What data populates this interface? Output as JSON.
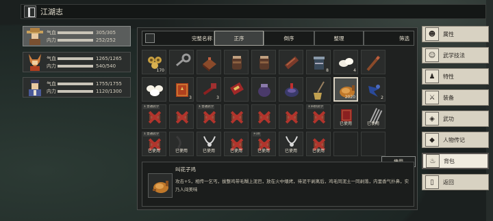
{
  "header": {
    "title": "江湖志"
  },
  "characters": [
    {
      "hp_label": "气血",
      "hp": "305/305",
      "mp_label": "内力",
      "mp": "252/252",
      "selected": true
    },
    {
      "hp_label": "气血",
      "hp": "1265/1265",
      "mp_label": "内力",
      "mp": "540/540",
      "selected": false
    },
    {
      "hp_label": "气血",
      "hp": "1755/1755",
      "mp_label": "内力",
      "mp": "1120/1300",
      "selected": false
    }
  ],
  "tabs": {
    "full_name": "完整名称",
    "sort_asc": "正序",
    "sort_desc": "倒序",
    "arrange": "整理",
    "filter": "筛选"
  },
  "items": [
    {
      "icon": "coins-icon",
      "count": "170",
      "badge": "",
      "used": ""
    },
    {
      "icon": "key-icon",
      "count": "",
      "badge": "",
      "used": ""
    },
    {
      "icon": "crate-icon",
      "count": "",
      "badge": "",
      "used": ""
    },
    {
      "icon": "jar-icon",
      "count": "",
      "badge": "",
      "used": ""
    },
    {
      "icon": "jar-icon",
      "count": "",
      "badge": "",
      "used": ""
    },
    {
      "icon": "scroll-icon",
      "count": "",
      "badge": "",
      "used": ""
    },
    {
      "icon": "pot-icon",
      "count": "8",
      "badge": "",
      "used": ""
    },
    {
      "icon": "bun-icon",
      "count": "4",
      "badge": "",
      "used": ""
    },
    {
      "icon": "stick-icon",
      "count": "",
      "badge": "",
      "used": ""
    },
    {
      "icon": "buns-icon",
      "count": "",
      "badge": "",
      "used": ""
    },
    {
      "icon": "book-icon",
      "count": "3",
      "badge": "",
      "used": ""
    },
    {
      "icon": "weapon-icon",
      "count": "3",
      "badge": "",
      "used": ""
    },
    {
      "icon": "banner-icon",
      "count": "",
      "badge": "",
      "used": ""
    },
    {
      "icon": "purple-jar-icon",
      "count": "",
      "badge": "",
      "used": ""
    },
    {
      "icon": "helmet-icon",
      "count": "",
      "badge": "",
      "used": ""
    },
    {
      "icon": "broom-icon",
      "count": "",
      "badge": "",
      "used": ""
    },
    {
      "icon": "roast-chicken-icon",
      "count": "2020",
      "badge": "",
      "used": ""
    },
    {
      "icon": "blue-bird-icon",
      "count": "2",
      "badge": "",
      "used": ""
    },
    {
      "icon": "crossed-icon",
      "count": "",
      "badge": "1 普通武学",
      "used": ""
    },
    {
      "icon": "crossed-icon",
      "count": "",
      "badge": "",
      "used": ""
    },
    {
      "icon": "crossed-icon",
      "count": "",
      "badge": "1 普通武学",
      "used": ""
    },
    {
      "icon": "crossed-icon",
      "count": "",
      "badge": "",
      "used": ""
    },
    {
      "icon": "crossed-icon",
      "count": "",
      "badge": "",
      "used": ""
    },
    {
      "icon": "crossed-icon",
      "count": "",
      "badge": "",
      "used": ""
    },
    {
      "icon": "crossed-icon",
      "count": "",
      "badge": "1 四阶武学",
      "used": ""
    },
    {
      "icon": "manual-icon",
      "count": "",
      "badge": "",
      "used": "已使用"
    },
    {
      "icon": "rake-icon",
      "count": "",
      "badge": "",
      "used": "已使用"
    },
    {
      "icon": "crossed-icon",
      "count": "",
      "badge": "1 普通武学",
      "used": "已使用"
    },
    {
      "icon": "whip-icon",
      "count": "",
      "badge": "",
      "used": "已使用"
    },
    {
      "icon": "necklace-icon",
      "count": "",
      "badge": "",
      "used": "已使用"
    },
    {
      "icon": "crossed-icon",
      "count": "",
      "badge": "",
      "used": "已使用"
    },
    {
      "icon": "crossed-icon",
      "count": "",
      "badge": "+10",
      "used": "已使用"
    },
    {
      "icon": "necklace-icon",
      "count": "",
      "badge": "",
      "used": "已使用"
    },
    {
      "icon": "crossed-icon",
      "count": "",
      "badge": "",
      "used": "已使用"
    },
    {
      "icon": "empty",
      "count": "",
      "badge": "",
      "used": ""
    },
    {
      "icon": "empty",
      "count": "",
      "badge": "",
      "used": ""
    }
  ],
  "detail": {
    "name": "叫花子鸡",
    "description": "攻击+5，相传一乞丐，拔整鸡带毛糊上泥巴，放在火中煨烤，待泥干剥离后，鸡毛同泥土一同剥落，内里香气扑鼻，实乃人间美味",
    "use_label": "使用"
  },
  "menu": [
    {
      "label": "属性",
      "icon": "person-icon"
    },
    {
      "label": "武学技法",
      "icon": "martial-icon"
    },
    {
      "label": "特性",
      "icon": "trait-icon"
    },
    {
      "label": "装备",
      "icon": "sword-icon"
    },
    {
      "label": "武功",
      "icon": "tag-icon"
    },
    {
      "label": "人物传记",
      "icon": "diamond-icon"
    },
    {
      "label": "背包",
      "icon": "bag-icon",
      "active": true
    },
    {
      "label": "返回",
      "icon": "door-icon"
    }
  ]
}
